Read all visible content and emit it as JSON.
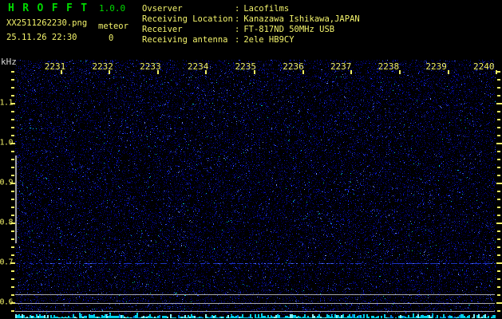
{
  "app": {
    "title": "H R O F F T",
    "version": "1.0.0"
  },
  "capture": {
    "filename": "XX2511262230.png",
    "mode_label": "meteor",
    "datetime": "25.11.26 22:30",
    "count": "0"
  },
  "station": {
    "separator": ":",
    "rows": [
      {
        "label": "Ovserver",
        "value": "Lacofilms"
      },
      {
        "label": "Receiving Location",
        "value": "Kanazawa Ishikawa,JAPAN"
      },
      {
        "label": "Receiver",
        "value": "FT-817ND 50MHz USB"
      },
      {
        "label": "Receiving antenna",
        "value": "2ele HB9CY"
      }
    ]
  },
  "chart_data": {
    "type": "heatmap",
    "title": "HROFFT 10-minute radio meteor spectrogram (22:30-22:40, 25.11.26)",
    "x_axis": {
      "tick_labels": [
        "2231",
        "2232",
        "2233",
        "2234",
        "2235",
        "2236",
        "2237",
        "2238",
        "2239",
        "2240"
      ],
      "range": [
        "22:30",
        "22:40"
      ],
      "unit": "hhmm"
    },
    "y_axis": {
      "unit": "kHz",
      "tick_labels": [
        "1.1",
        "1.0",
        "0.9",
        "0.8",
        "0.7",
        "0.6"
      ],
      "range": [
        0.56,
        1.18
      ],
      "direction": "descending",
      "minor_tick_khz": 0.02
    },
    "meteor_count": 0,
    "content": "uniform dark-blue background noise, no meteor echoes",
    "features": [
      {
        "type": "carrier-line",
        "freq_khz": 0.7,
        "extent": "full width",
        "appearance": "faint dotted blue line"
      },
      {
        "type": "reference-lines",
        "freq_khz": [
          0.62,
          0.6,
          0.58
        ],
        "appearance": "three gray horizontal lines"
      },
      {
        "type": "vertical-marker",
        "x": "left edge",
        "freq_span_khz": [
          0.75,
          0.97
        ],
        "appearance": "gray vertical bar"
      },
      {
        "type": "signal-level-trace",
        "position": "bottom strip",
        "appearance": "bright cyan noise comb"
      }
    ],
    "legend": "none",
    "grid": "off"
  },
  "colors": {
    "background": "#000000",
    "title_green": "#00d800",
    "text_yellow": "#f3f36b",
    "axis_unit_white": "#d9d9d9",
    "noise_blue": "#0000c8",
    "bright_blue": "#4060ff",
    "trace_cyan": "#00e0f0",
    "line_gray": "#9b9b9b"
  }
}
